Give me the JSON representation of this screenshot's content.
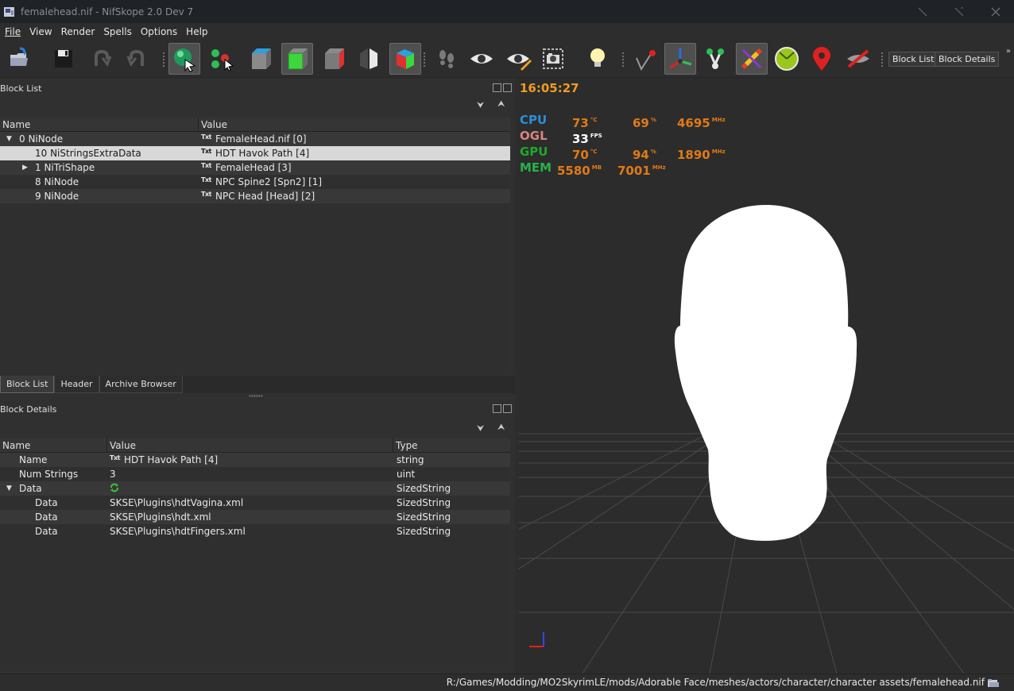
{
  "window": {
    "title": "femalehead.nif - NifSkope 2.0 Dev 7"
  },
  "menu": [
    "File",
    "View",
    "Render",
    "Spells",
    "Options",
    "Help"
  ],
  "toolbar": {
    "icons": [
      "load-icon",
      "save-icon",
      "undo-icon",
      "redo-icon",
      "select-object-icon",
      "select-vertex-icon",
      "view-top-icon",
      "view-front-icon",
      "view-side-icon",
      "view-walk-icon",
      "view-user-icon",
      "walk-icon",
      "show-hidden-icon",
      "show-nodes-icon",
      "screenshot-icon",
      "lighting-icon",
      "show-axes-icon",
      "show-constraints-icon",
      "show-markers-icon",
      "show-skeleton-icon",
      "textures-icon",
      "frame-icon",
      "marker-icon",
      "hide-icon"
    ],
    "block_list_label": "Block List",
    "block_details_label": "Block Details",
    "extension": "»"
  },
  "block_list": {
    "title": "Block List",
    "columns": [
      "Name",
      "Value"
    ],
    "rows": [
      {
        "name": "0 NiNode",
        "value": "FemaleHead.nif [0]",
        "expander": "▼"
      },
      {
        "name": "10 NiStringsExtraData",
        "value": "HDT Havok Path [4]",
        "expander": ""
      },
      {
        "name": "1 NiTriShape",
        "value": "FemaleHead [3]",
        "expander": "▶"
      },
      {
        "name": "8 NiNode",
        "value": "NPC Spine2 [Spn2] [1]",
        "expander": ""
      },
      {
        "name": "9 NiNode",
        "value": "NPC Head [Head] [2]",
        "expander": ""
      }
    ],
    "txt_icon": "Txt",
    "collapse_all": "⮟",
    "expand_all": "⮝"
  },
  "tabs": [
    "Block List",
    "Header",
    "Archive Browser"
  ],
  "block_details": {
    "title": "Block Details",
    "columns": [
      "Name",
      "Value",
      "Type"
    ],
    "rows": [
      {
        "name": "Name",
        "value": "HDT Havok Path [4]",
        "type": "string",
        "expander": "",
        "icon": "txt"
      },
      {
        "name": "Num Strings",
        "value": "3",
        "type": "uint",
        "expander": "",
        "icon": ""
      },
      {
        "name": "Data",
        "value": "",
        "type": "SizedString",
        "expander": "▼",
        "icon": "refresh"
      },
      {
        "name": "Data",
        "value": "SKSE\\Plugins\\hdtVagina.xml",
        "type": "SizedString",
        "expander": "",
        "icon": ""
      },
      {
        "name": "Data",
        "value": "SKSE\\Plugins\\hdt.xml",
        "type": "SizedString",
        "expander": "",
        "icon": ""
      },
      {
        "name": "Data",
        "value": "SKSE\\Plugins\\hdtFingers.xml",
        "type": "SizedString",
        "expander": "",
        "icon": ""
      }
    ]
  },
  "overlay": {
    "time": "16:05:27",
    "cpu": {
      "label": "CPU",
      "temp": "73",
      "temp_unit": "°C",
      "load": "69",
      "load_unit": "%",
      "clock": "4695",
      "clock_unit": "MHz"
    },
    "ogl": {
      "label": "OGL",
      "fps": "33",
      "fps_unit": "FPS"
    },
    "gpu": {
      "label": "GPU",
      "temp": "70",
      "temp_unit": "°C",
      "load": "94",
      "load_unit": "%",
      "clock": "1890",
      "clock_unit": "MHz"
    },
    "mem": {
      "label": "MEM",
      "used": "5580",
      "used_unit": "MB",
      "clock": "7001",
      "clock_unit": "MHz"
    },
    "colors": {
      "time": "#f29b21",
      "cpu": "#2a8fd6",
      "ogl": "#d9847f",
      "gpu": "#1fa82a",
      "mem": "#27b34a",
      "value": "#e07a16",
      "ogl_value": "#ffffff"
    }
  },
  "status": {
    "path": "R:/Games/Modding/MO2SkyrimLE/mods/Adorable Face/meshes/actors/character/character assets/femalehead.nif"
  }
}
